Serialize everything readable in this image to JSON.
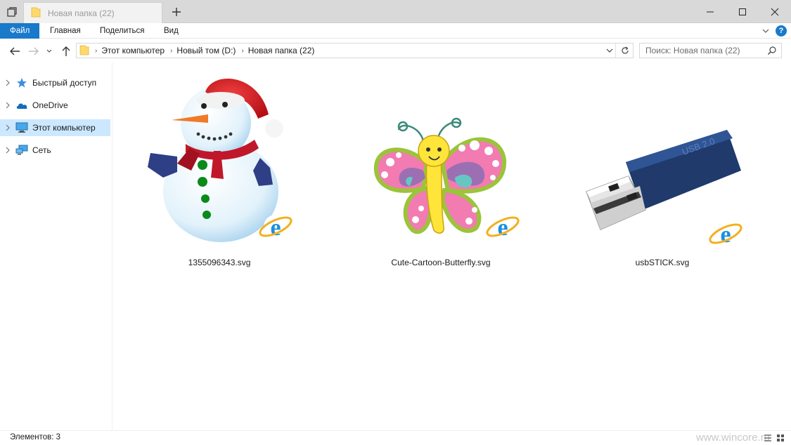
{
  "window": {
    "tab_title": "Новая папка (22)",
    "new_tab": "+"
  },
  "ribbon": {
    "file": "Файл",
    "home": "Главная",
    "share": "Поделиться",
    "view": "Вид"
  },
  "address": {
    "crumbs": [
      "Этот компьютер",
      "Новый том (D:)",
      "Новая папка (22)"
    ]
  },
  "search": {
    "placeholder": "Поиск: Новая папка (22)"
  },
  "nav_pane": {
    "items": [
      {
        "label": "Быстрый доступ",
        "icon": "star-icon",
        "selected": false
      },
      {
        "label": "OneDrive",
        "icon": "cloud-icon",
        "selected": false
      },
      {
        "label": "Этот компьютер",
        "icon": "computer-icon",
        "selected": true
      },
      {
        "label": "Сеть",
        "icon": "network-icon",
        "selected": false
      }
    ]
  },
  "files": [
    {
      "name": "1355096343.svg",
      "thumbnail": "snowman-thumbnail"
    },
    {
      "name": "Cute-Cartoon-Butterfly.svg",
      "thumbnail": "butterfly-thumbnail"
    },
    {
      "name": "usbSTICK.svg",
      "thumbnail": "usb-stick-thumbnail",
      "thumb_text": "USB 2.0"
    }
  ],
  "status": {
    "item_count": "Элементов: 3",
    "watermark": "www.wincore.ru"
  },
  "colors": {
    "accent": "#1979ca",
    "selection": "#cce8ff",
    "folder": "#ffd96b"
  }
}
